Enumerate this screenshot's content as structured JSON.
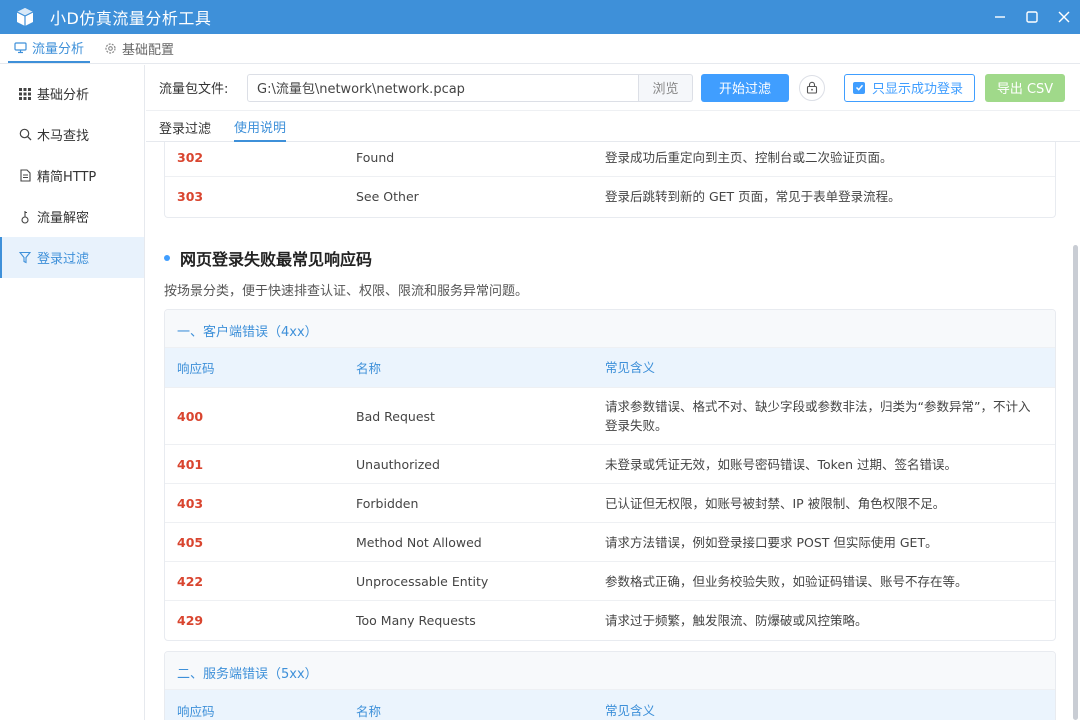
{
  "app": {
    "title": "小D仿真流量分析工具"
  },
  "topnav": [
    {
      "label": "流量分析",
      "icon": "monitor-icon",
      "active": true
    },
    {
      "label": "基础配置",
      "icon": "gear-icon",
      "active": false
    }
  ],
  "sidebar": [
    {
      "label": "基础分析",
      "icon": "grid-icon"
    },
    {
      "label": "木马查找",
      "icon": "search-icon"
    },
    {
      "label": "精简HTTP",
      "icon": "document-icon"
    },
    {
      "label": "流量解密",
      "icon": "key-icon"
    },
    {
      "label": "登录过滤",
      "icon": "filter-icon",
      "active": true
    }
  ],
  "toolbar": {
    "file_label": "流量包文件:",
    "file_value": "G:\\流量包\\network\\network.pcap",
    "browse_label": "浏览",
    "start_label": "开始过滤",
    "success_only_label": "只显示成功登录",
    "export_label": "导出 CSV"
  },
  "tabs": [
    {
      "label": "登录过滤",
      "active": false
    },
    {
      "label": "使用说明",
      "active": true
    }
  ],
  "redirect_rows": [
    {
      "code": "302",
      "name": "Found",
      "desc": "登录成功后重定向到主页、控制台或二次验证页面。"
    },
    {
      "code": "303",
      "name": "See Other",
      "desc": "登录后跳转到新的 GET 页面，常见于表单登录流程。"
    }
  ],
  "failure_section": {
    "title": "网页登录失败最常见响应码",
    "subtitle": "按场景分类，便于快速排查认证、权限、限流和服务异常问题。"
  },
  "table_headers": {
    "code": "响应码",
    "name": "名称",
    "desc": "常见含义"
  },
  "client_group": {
    "title": "一、客户端错误（4xx）",
    "rows": [
      {
        "code": "400",
        "name": "Bad Request",
        "desc": "请求参数错误、格式不对、缺少字段或参数非法，归类为“参数异常”，不计入登录失败。"
      },
      {
        "code": "401",
        "name": "Unauthorized",
        "desc": "未登录或凭证无效，如账号密码错误、Token 过期、签名错误。"
      },
      {
        "code": "403",
        "name": "Forbidden",
        "desc": "已认证但无权限，如账号被封禁、IP 被限制、角色权限不足。"
      },
      {
        "code": "405",
        "name": "Method Not Allowed",
        "desc": "请求方法错误，例如登录接口要求 POST 但实际使用 GET。"
      },
      {
        "code": "422",
        "name": "Unprocessable Entity",
        "desc": "参数格式正确，但业务校验失败，如验证码错误、账号不存在等。"
      },
      {
        "code": "429",
        "name": "Too Many Requests",
        "desc": "请求过于频繁，触发限流、防爆破或风控策略。"
      }
    ]
  },
  "server_group": {
    "title": "二、服务端错误（5xx）"
  },
  "colors": {
    "accent": "#3e90d9",
    "primary_button": "#409eff",
    "export_button": "#a0d98a",
    "code_text": "#d9452f"
  }
}
